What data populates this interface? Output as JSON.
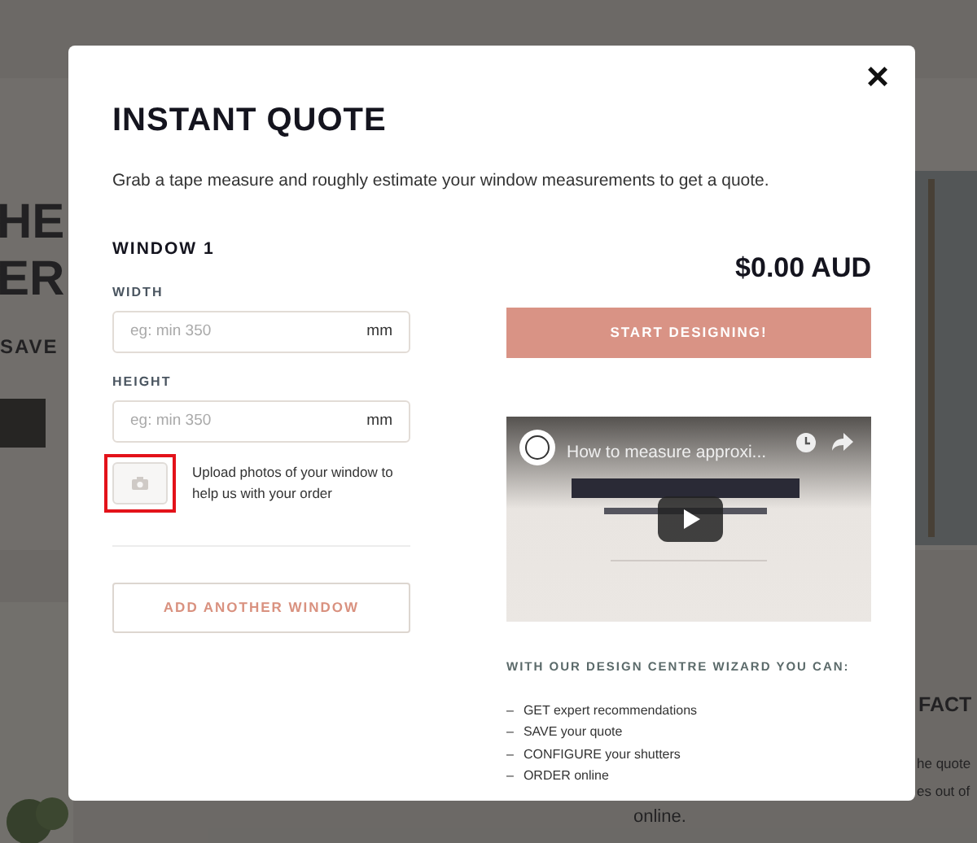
{
  "background": {
    "hero_lines": [
      "HE",
      "ER"
    ],
    "offer": "SAVE",
    "section_heading": "FACT",
    "body_lines": [
      "he quote",
      "es out of",
      "online."
    ]
  },
  "modal": {
    "title": "INSTANT QUOTE",
    "close": "×",
    "intro": "Grab a tape measure and roughly estimate your window measurements to get a quote.",
    "window_heading": "WINDOW 1",
    "fields": [
      {
        "label": "WIDTH",
        "placeholder": "eg: min 350",
        "unit": "mm"
      },
      {
        "label": "HEIGHT",
        "placeholder": "eg: min 350",
        "unit": "mm"
      }
    ],
    "upload": {
      "text": "Upload photos of your window to help us with your order",
      "highlighted": true
    },
    "add_button": "ADD ANOTHER WINDOW",
    "price": "$0.00 AUD",
    "start_button": "START DESIGNING!",
    "video": {
      "title": "How to measure approxi..."
    },
    "wizard_heading": "WITH OUR DESIGN CENTRE WIZARD YOU CAN:",
    "wizard_items": [
      {
        "dash": "–",
        "strong": "GET",
        "rest": "expert recommendations"
      },
      {
        "dash": "–",
        "strong": "SAVE",
        "rest": "your quote"
      },
      {
        "dash": "–",
        "strong": "CONFIGURE",
        "rest": "your shutters"
      },
      {
        "dash": "–",
        "strong": "ORDER",
        "rest": "online"
      }
    ]
  }
}
